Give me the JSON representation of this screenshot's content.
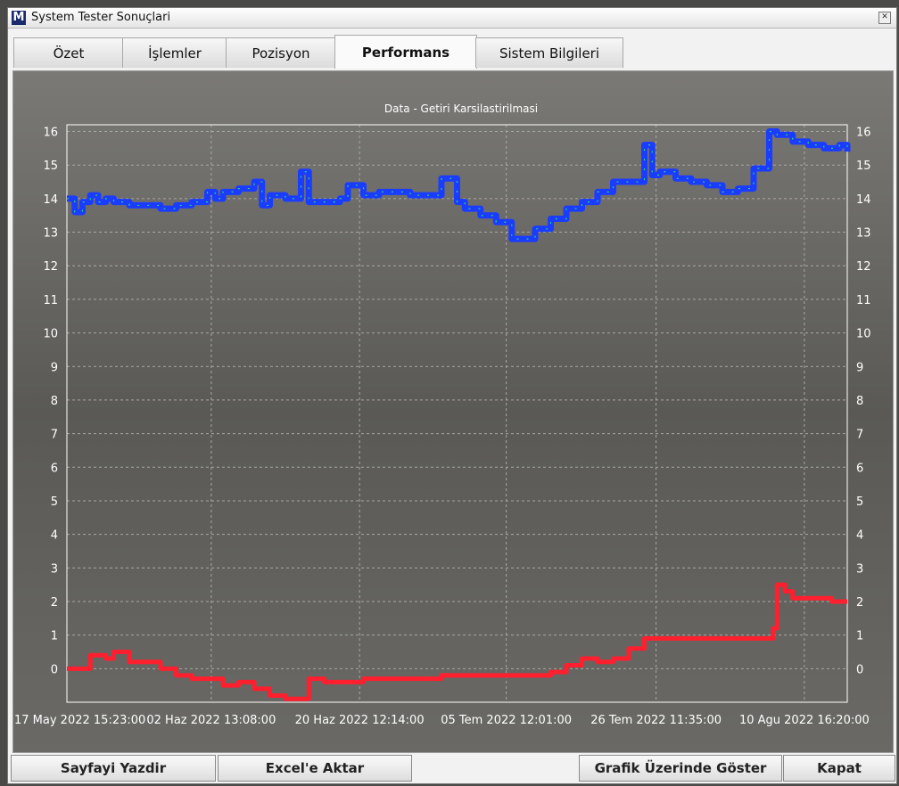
{
  "window": {
    "title": "System Tester Sonuçlari",
    "logo": "M",
    "close_glyph": "✕"
  },
  "tabs": [
    {
      "label": "Özet",
      "active": false
    },
    {
      "label": "İşlemler",
      "active": false
    },
    {
      "label": "Pozisyon",
      "active": false
    },
    {
      "label": "Performans",
      "active": true
    },
    {
      "label": "Sistem Bilgileri",
      "active": false
    }
  ],
  "buttons": {
    "print": "Sayfayi Yazdir",
    "excel": "Excel'e Aktar",
    "show_on_chart": "Grafik Üzerinde Göster",
    "close": "Kapat"
  },
  "chart_data": {
    "type": "line",
    "title": "Data - Getiri Karsilastirilmasi",
    "ylim": [
      -1,
      16.2
    ],
    "y_ticks": [
      0,
      1,
      2,
      3,
      4,
      5,
      6,
      7,
      8,
      9,
      10,
      11,
      12,
      13,
      14,
      15,
      16
    ],
    "x_tick_labels": [
      "17 May 2022 15:23:00",
      "02 Haz 2022 13:08:00",
      "20 Haz 2022 12:14:00",
      "05 Tem 2022 12:01:00",
      "26 Tem 2022 11:35:00",
      "10 Agu 2022 16:20:00"
    ],
    "grid": true,
    "background_color": "#5f5e5a",
    "series": [
      {
        "color": "#1a3cff",
        "accent_color": "#2ad66a",
        "x": [
          0,
          0.01,
          0.02,
          0.03,
          0.04,
          0.05,
          0.06,
          0.08,
          0.1,
          0.12,
          0.14,
          0.16,
          0.18,
          0.19,
          0.2,
          0.22,
          0.24,
          0.25,
          0.26,
          0.28,
          0.3,
          0.31,
          0.33,
          0.35,
          0.36,
          0.38,
          0.4,
          0.42,
          0.44,
          0.46,
          0.48,
          0.5,
          0.51,
          0.53,
          0.55,
          0.57,
          0.58,
          0.6,
          0.62,
          0.64,
          0.66,
          0.68,
          0.7,
          0.72,
          0.74,
          0.75,
          0.76,
          0.78,
          0.8,
          0.82,
          0.84,
          0.86,
          0.88,
          0.9,
          0.91,
          0.93,
          0.95,
          0.97,
          0.99,
          1.0
        ],
        "y": [
          14.0,
          13.6,
          13.9,
          14.1,
          13.9,
          14.0,
          13.9,
          13.8,
          13.8,
          13.7,
          13.8,
          13.9,
          14.2,
          14.0,
          14.2,
          14.3,
          14.5,
          13.8,
          14.1,
          14.0,
          14.8,
          13.9,
          13.9,
          14.0,
          14.4,
          14.1,
          14.2,
          14.2,
          14.1,
          14.1,
          14.6,
          13.9,
          13.7,
          13.5,
          13.3,
          12.8,
          12.8,
          13.1,
          13.4,
          13.7,
          13.9,
          14.2,
          14.5,
          14.5,
          15.6,
          14.7,
          14.8,
          14.6,
          14.5,
          14.4,
          14.2,
          14.3,
          14.9,
          16.0,
          15.9,
          15.7,
          15.6,
          15.5,
          15.6,
          15.4
        ]
      },
      {
        "color": "#ff1f2e",
        "x": [
          0,
          0.02,
          0.03,
          0.05,
          0.06,
          0.08,
          0.1,
          0.12,
          0.14,
          0.16,
          0.18,
          0.19,
          0.2,
          0.22,
          0.24,
          0.26,
          0.28,
          0.3,
          0.31,
          0.33,
          0.35,
          0.38,
          0.4,
          0.45,
          0.48,
          0.5,
          0.55,
          0.6,
          0.62,
          0.64,
          0.66,
          0.68,
          0.7,
          0.72,
          0.73,
          0.74,
          0.76,
          0.8,
          0.85,
          0.9,
          0.905,
          0.91,
          0.92,
          0.93,
          0.95,
          0.98,
          1.0
        ],
        "y": [
          0,
          0,
          0.4,
          0.3,
          0.5,
          0.2,
          0.2,
          0.0,
          -0.2,
          -0.3,
          -0.3,
          -0.3,
          -0.5,
          -0.4,
          -0.6,
          -0.8,
          -0.9,
          -0.9,
          -0.3,
          -0.4,
          -0.4,
          -0.3,
          -0.3,
          -0.3,
          -0.2,
          -0.2,
          -0.2,
          -0.2,
          -0.1,
          0.1,
          0.3,
          0.2,
          0.3,
          0.6,
          0.6,
          0.9,
          0.9,
          0.9,
          0.9,
          0.9,
          1.2,
          2.5,
          2.3,
          2.1,
          2.1,
          2.0,
          2.0
        ]
      }
    ]
  }
}
